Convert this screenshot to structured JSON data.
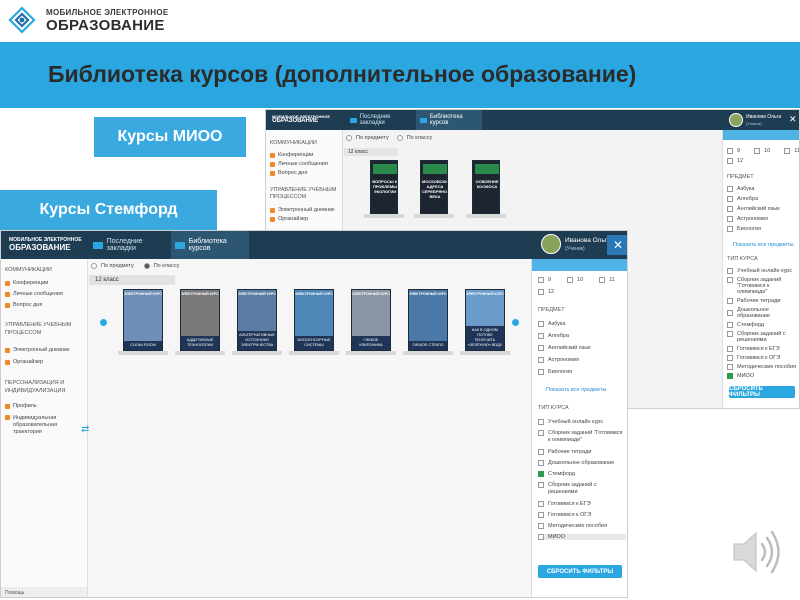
{
  "header": {
    "logo_line1": "МОБИЛЬНОЕ ЭЛЕКТРОННОЕ",
    "logo_line2": "ОБРАЗОВАНИЕ"
  },
  "slide_title": "Библиотека курсов (дополнительное образование)",
  "labels": {
    "mioo": "Курсы МИОО",
    "stemford": "Курсы Стемфорд"
  },
  "app": {
    "brand_line1": "МОБИЛЬНОЕ ЭЛЕКТРОННОЕ",
    "brand_line2": "ОБРАЗОВАНИЕ",
    "tabs": [
      "Последние закладки",
      "Библиотека курсов"
    ],
    "user_name": "Иванова Ольга",
    "user_role": "(Ученик)",
    "close": "✕"
  },
  "win1": {
    "sort_options": [
      "По предмету",
      "По классу"
    ],
    "class_chip": "12 класс",
    "nav": {
      "section1": "КОММУНИКАЦИИ",
      "items1": [
        "Конференции",
        "Личные сообщения",
        "Вопрос дня"
      ],
      "section2": "УПРАВЛЕНИЕ УЧЕБНЫМ ПРОЦЕССОМ",
      "items2": [
        "Электронный дневник",
        "Органайзер"
      ]
    },
    "books": [
      {
        "title": "ВОПРОСЫ И ПРОБЛЕМЫ ЭКОЛОГИИ"
      },
      {
        "title": "МОСКОВСКИЕ АДРЕСА СЕРЕБРЯНОГО ВЕКА"
      },
      {
        "title": "ОСВОЕНИЕ КОСМОСА"
      }
    ],
    "filter": {
      "grades": [
        "9",
        "10",
        "11",
        "12"
      ],
      "subject_header": "ПРЕДМЕТ",
      "subjects": [
        "Азбука",
        "Алгебра",
        "Английский язык",
        "Астрономия",
        "Биология"
      ],
      "show_all": "Показать все предметы",
      "type_header": "ТИП КУРСА",
      "types": [
        "Учебный онлайн курс",
        "Сборник заданий \"Готовимся к олимпиаде\"",
        "Рабочие тетради",
        "Дошкольное образование",
        "Стемфорд",
        "Сборник заданий с решениями",
        "Готовимся к ЕГЭ",
        "Готовимся к ОГЭ",
        "Методические пособия",
        "МИОО"
      ],
      "reset": "СБРОСИТЬ ФИЛЬТРЫ"
    }
  },
  "win2": {
    "sort_options": [
      "По предмету",
      "По классу"
    ],
    "class_chip": "12 класс",
    "nav": {
      "section1": "КОММУНИКАЦИИ",
      "items1": [
        "Конференции",
        "Личные сообщения",
        "Вопрос дня"
      ],
      "section2": "УПРАВЛЕНИЕ УЧЕБНЫМ ПРОЦЕССОМ",
      "items2": [
        "Электронный дневник",
        "Органайзер"
      ],
      "section3": "ПЕРСОНАЛИЗАЦИЯ И ИНДИВИДУАЛИЗАЦИЯ",
      "items3": [
        "Профиль",
        "Индивидуальная образовательная траектория"
      ]
    },
    "books": [
      {
        "badge": "ЭЛЕКТРОННЫЙ КУРС",
        "title": "CLEAN ROOM",
        "color": "#6f8fb8"
      },
      {
        "badge": "ЭЛЕКТРОННЫЙ КУРС",
        "title": "АДДИТИВНЫЕ ТЕХНОЛОГИИ",
        "color": "#7a7a7a"
      },
      {
        "badge": "ЭЛЕКТРОННЫЙ КУРС",
        "title": "АЛЬТЕРНАТИВНЫЕ ИСТОЧНИКИ ЭЛЕКТРИЧЕСТВА",
        "color": "#5b7da3"
      },
      {
        "badge": "ЭЛЕКТРОННЫЙ КУРС",
        "title": "БИОСЕНСОРНЫЕ СИСТЕМЫ",
        "color": "#4f86b8"
      },
      {
        "badge": "ЭЛЕКТРОННЫЙ КУРС",
        "title": "ГИБКОЕ КЛИПОНИКА",
        "color": "#8a96a6"
      },
      {
        "badge": "ЭЛЕКТРОННЫЙ КУРС",
        "title": "ГИБКОЕ СТЕКЛО",
        "color": "#4b79a8"
      },
      {
        "badge": "ЭЛЕКТРОННЫЙ КУРС",
        "title": "КАК В ОДНОМ ПОТОКЕ ПОЛУЧИТЬ «ЗЕЛЁНУЮ» ВОДУ",
        "color": "#6a9bc9"
      }
    ],
    "filter": {
      "grades": [
        "9",
        "10",
        "11",
        "12"
      ],
      "subject_header": "ПРЕДМЕТ",
      "subjects": [
        "Азбука",
        "Алгебра",
        "Английский язык",
        "Астрономия",
        "Биология"
      ],
      "show_all": "Показать все предметы",
      "type_header": "ТИП КУРСА",
      "types": [
        "Учебный онлайн курс",
        "Сборник заданий \"Готовимся к олимпиаде\"",
        "Рабочие тетради",
        "Дошкольное образование",
        "Стемфорд",
        "Сборник заданий с решениями",
        "Готовимся к ЕГЭ",
        "Готовимся к ОГЭ",
        "Методические пособия",
        "МИОО"
      ],
      "checked_type": "Стемфорд",
      "reset": "СБРОСИТЬ ФИЛЬТРЫ"
    },
    "footer": "Помощь"
  },
  "icons": [
    "logo-icon",
    "bookmark-icon",
    "book-icon",
    "avatar-icon",
    "close-icon",
    "filter-icon",
    "speaker-icon"
  ],
  "colors": {
    "band": "#2aa7e0",
    "label": "#39a9e0",
    "app_topbar": "#1f3d52",
    "nav_accent": "#f08a24"
  }
}
